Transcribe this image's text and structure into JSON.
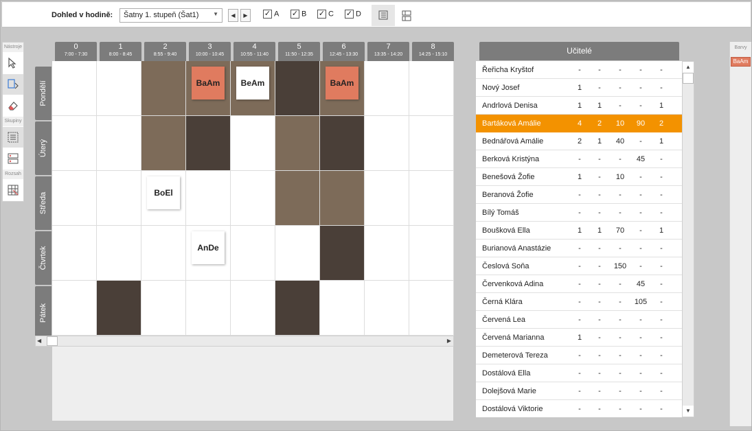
{
  "toolbar": {
    "label": "Dohled v hodině:",
    "select_value": "Šatny 1. stupeň (Šat1)",
    "checks": [
      {
        "label": "A",
        "checked": true
      },
      {
        "label": "B",
        "checked": true
      },
      {
        "label": "C",
        "checked": true
      },
      {
        "label": "D",
        "checked": true
      }
    ]
  },
  "tool_panel": {
    "sections": [
      "Nástroje",
      "Skupiny",
      "Rozsah"
    ]
  },
  "periods": [
    {
      "num": "0",
      "time": "7:00 - 7:30"
    },
    {
      "num": "1",
      "time": "8:00 - 8:45"
    },
    {
      "num": "2",
      "time": "8:55 - 9:40"
    },
    {
      "num": "3",
      "time": "10:00 - 10:45"
    },
    {
      "num": "4",
      "time": "10:55 - 11:40"
    },
    {
      "num": "5",
      "time": "11:50 - 12:35"
    },
    {
      "num": "6",
      "time": "12:45 - 13:30"
    },
    {
      "num": "7",
      "time": "13:35 - 14:20"
    },
    {
      "num": "8",
      "time": "14:25 - 15:10"
    }
  ],
  "days": [
    "Pondělí",
    "Úterý",
    "Středa",
    "Čtvrtek",
    "Pátek"
  ],
  "colors": {
    "light": "#7d6b59",
    "dark": "#4a3f38",
    "salmon": "#e07b5f",
    "white": "#ffffff",
    "selected_row": "#f39200"
  },
  "cell_shading": [
    {
      "day": 0,
      "period": 2,
      "shade": "light"
    },
    {
      "day": 0,
      "period": 3,
      "shade": "light"
    },
    {
      "day": 0,
      "period": 4,
      "shade": "light"
    },
    {
      "day": 0,
      "period": 5,
      "shade": "dark"
    },
    {
      "day": 0,
      "period": 6,
      "shade": "light"
    },
    {
      "day": 1,
      "period": 2,
      "shade": "light"
    },
    {
      "day": 1,
      "period": 3,
      "shade": "dark"
    },
    {
      "day": 1,
      "period": 5,
      "shade": "light"
    },
    {
      "day": 1,
      "period": 6,
      "shade": "dark"
    },
    {
      "day": 2,
      "period": 5,
      "shade": "light"
    },
    {
      "day": 2,
      "period": 6,
      "shade": "light"
    },
    {
      "day": 3,
      "period": 6,
      "shade": "dark"
    },
    {
      "day": 4,
      "period": 1,
      "shade": "dark"
    },
    {
      "day": 4,
      "period": 5,
      "shade": "dark"
    }
  ],
  "lessons": [
    {
      "day": 0,
      "period": 3,
      "label": "BaAm",
      "bg": "salmon"
    },
    {
      "day": 0,
      "period": 4,
      "label": "BeAm",
      "bg": "white"
    },
    {
      "day": 0,
      "period": 6,
      "label": "BaAm",
      "bg": "salmon"
    },
    {
      "day": 2,
      "period": 2,
      "label": "BoEl",
      "bg": "white"
    },
    {
      "day": 3,
      "period": 3,
      "label": "AnDe",
      "bg": "white"
    }
  ],
  "teachers_title": "Učitelé",
  "teachers": [
    {
      "name": "Řeřicha Kryštof",
      "v": [
        "-",
        "-",
        "-",
        "-",
        "-"
      ]
    },
    {
      "name": "Nový Josef",
      "v": [
        "1",
        "-",
        "-",
        "-",
        "-"
      ]
    },
    {
      "name": "Andrlová Denisa",
      "v": [
        "1",
        "1",
        "-",
        "-",
        "1"
      ]
    },
    {
      "name": "Bartáková Amálie",
      "v": [
        "4",
        "2",
        "10",
        "90",
        "2"
      ],
      "selected": true
    },
    {
      "name": "Bednářová Amálie",
      "v": [
        "2",
        "1",
        "40",
        "-",
        "1"
      ]
    },
    {
      "name": "Berková Kristýna",
      "v": [
        "-",
        "-",
        "-",
        "45",
        "-"
      ]
    },
    {
      "name": "Benešová Žofie",
      "v": [
        "1",
        "-",
        "10",
        "-",
        "-"
      ]
    },
    {
      "name": "Beranová Žofie",
      "v": [
        "-",
        "-",
        "-",
        "-",
        "-"
      ]
    },
    {
      "name": "Bílý Tomáš",
      "v": [
        "-",
        "-",
        "-",
        "-",
        "-"
      ]
    },
    {
      "name": "Boušková Ella",
      "v": [
        "1",
        "1",
        "70",
        "-",
        "1"
      ]
    },
    {
      "name": "Burianová Anastázie",
      "v": [
        "-",
        "-",
        "-",
        "-",
        "-"
      ]
    },
    {
      "name": "Česlová Soňa",
      "v": [
        "-",
        "-",
        "150",
        "-",
        "-"
      ]
    },
    {
      "name": "Červenková Adina",
      "v": [
        "-",
        "-",
        "-",
        "45",
        "-"
      ]
    },
    {
      "name": "Černá Klára",
      "v": [
        "-",
        "-",
        "-",
        "105",
        "-"
      ]
    },
    {
      "name": "Červená Lea",
      "v": [
        "-",
        "-",
        "-",
        "-",
        "-"
      ]
    },
    {
      "name": "Červená Marianna",
      "v": [
        "1",
        "-",
        "-",
        "-",
        "-"
      ]
    },
    {
      "name": "Demeterová Tereza",
      "v": [
        "-",
        "-",
        "-",
        "-",
        "-"
      ]
    },
    {
      "name": "Dostálová Ella",
      "v": [
        "-",
        "-",
        "-",
        "-",
        "-"
      ]
    },
    {
      "name": "Dolejšová Marie",
      "v": [
        "-",
        "-",
        "-",
        "-",
        "-"
      ]
    },
    {
      "name": "Dostálová Viktorie",
      "v": [
        "-",
        "-",
        "-",
        "-",
        "-"
      ]
    }
  ],
  "colors_panel": {
    "title": "Barvy",
    "swatch_label": "BaAm"
  }
}
